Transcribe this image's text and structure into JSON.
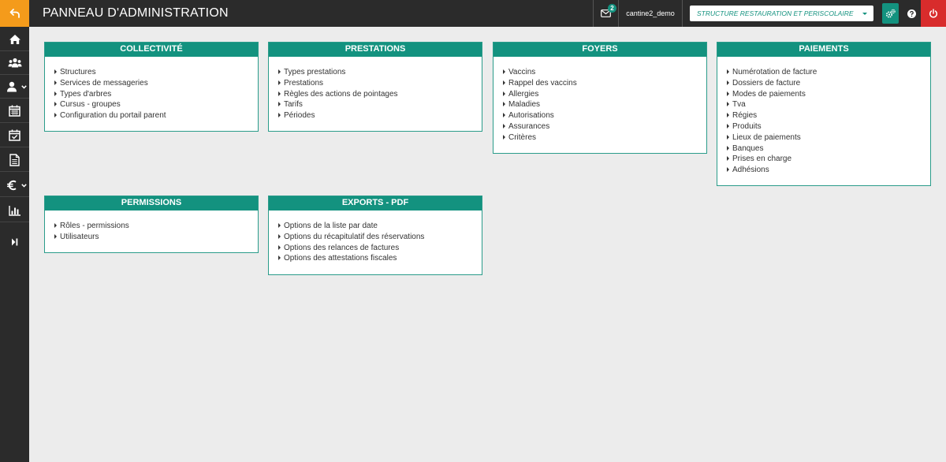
{
  "topbar": {
    "title": "PANNEAU D'ADMINISTRATION",
    "mail_count": "2",
    "username": "cantine2_demo",
    "structure_selected": "STRUCTURE RESTAURATION ET PERISCOLAIRE"
  },
  "colors": {
    "accent": "#13927f",
    "back_button": "#f49b1b",
    "power_button": "#d82c2c",
    "topbar_bg": "#2b2b2b",
    "page_bg": "#ececec"
  },
  "sidebar": {
    "items": [
      {
        "icon": "home-icon"
      },
      {
        "icon": "users-group-icon"
      },
      {
        "icon": "user-icon",
        "has_dropdown": true
      },
      {
        "icon": "calendar-icon"
      },
      {
        "icon": "calendar-check-icon"
      },
      {
        "icon": "document-icon"
      },
      {
        "icon": "euro-icon",
        "has_dropdown": true
      },
      {
        "icon": "bar-chart-icon"
      },
      {
        "icon": "expand-sidebar-icon"
      }
    ]
  },
  "panels": {
    "collectivite": {
      "title": "COLLECTIVITÉ",
      "items": [
        "Structures",
        "Services de messageries",
        "Types d'arbres",
        "Cursus - groupes",
        "Configuration du portail parent"
      ]
    },
    "prestations": {
      "title": "PRESTATIONS",
      "items": [
        "Types prestations",
        "Prestations",
        "Règles des actions de pointages",
        "Tarifs",
        "Périodes"
      ]
    },
    "foyers": {
      "title": "FOYERS",
      "items": [
        "Vaccins",
        "Rappel des vaccins",
        "Allergies",
        "Maladies",
        "Autorisations",
        "Assurances",
        "Critères"
      ]
    },
    "paiements": {
      "title": "PAIEMENTS",
      "items": [
        "Numérotation de facture",
        "Dossiers de facture",
        "Modes de paiements",
        "Tva",
        "Régies",
        "Produits",
        "Lieux de paiements",
        "Banques",
        "Prises en charge",
        "Adhésions"
      ]
    },
    "permissions": {
      "title": "PERMISSIONS",
      "items": [
        "Rôles - permissions",
        "Utilisateurs"
      ]
    },
    "exports": {
      "title": "EXPORTS - PDF",
      "items": [
        "Options de la liste par date",
        "Options du récapitulatif des réservations",
        "Options des relances de factures",
        "Options des attestations fiscales"
      ]
    }
  }
}
